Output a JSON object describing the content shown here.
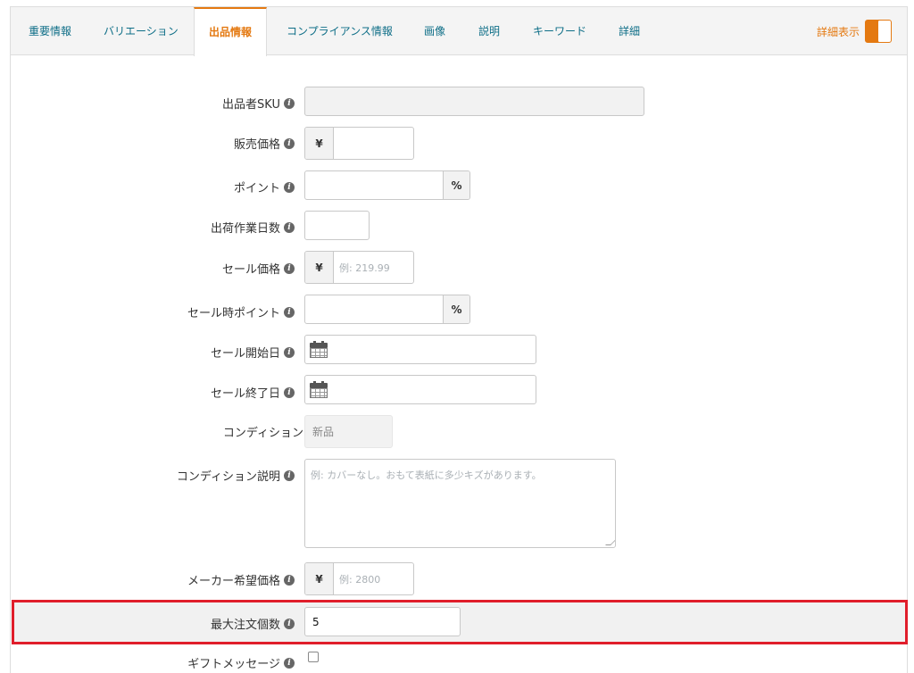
{
  "tabs": [
    {
      "label": "重要情報",
      "active": false
    },
    {
      "label": "バリエーション",
      "active": false
    },
    {
      "label": "出品情報",
      "active": true
    },
    {
      "label": "コンプライアンス情報",
      "active": false
    },
    {
      "label": "画像",
      "active": false
    },
    {
      "label": "説明",
      "active": false
    },
    {
      "label": "キーワード",
      "active": false
    },
    {
      "label": "詳細",
      "active": false
    }
  ],
  "detail_toggle": {
    "label": "詳細表示",
    "on": true
  },
  "accent_color": "#e47911",
  "highlight_color": "#e01e2b",
  "form": {
    "seller_sku": {
      "label": "出品者SKU",
      "value": ""
    },
    "price": {
      "label": "販売価格",
      "currency": "¥",
      "value": ""
    },
    "points": {
      "label": "ポイント",
      "unit": "%",
      "value": ""
    },
    "handling_days": {
      "label": "出荷作業日数",
      "value": ""
    },
    "sale_price": {
      "label": "セール価格",
      "currency": "¥",
      "placeholder": "例: 219.99"
    },
    "sale_points": {
      "label": "セール時ポイント",
      "unit": "%",
      "value": ""
    },
    "sale_start": {
      "label": "セール開始日",
      "icon": "calendar-icon"
    },
    "sale_end": {
      "label": "セール終了日",
      "icon": "calendar-icon"
    },
    "condition": {
      "label": "コンディション",
      "value": "新品"
    },
    "condition_note": {
      "label": "コンディション説明",
      "placeholder": "例: カバーなし。おもて表紙に多少キズがあります。"
    },
    "msrp": {
      "label": "メーカー希望価格",
      "currency": "¥",
      "placeholder": "例: 2800"
    },
    "max_order_qty": {
      "label": "最大注文個数",
      "value": "5"
    },
    "gift_message": {
      "label": "ギフトメッセージ",
      "checked": false
    }
  },
  "info_glyph": "i"
}
